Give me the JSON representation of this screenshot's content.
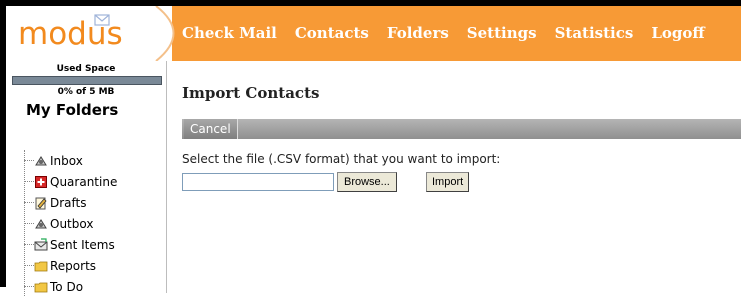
{
  "app": {
    "logo_text": "modus"
  },
  "nav": {
    "items": [
      {
        "label": "Check Mail"
      },
      {
        "label": "Contacts"
      },
      {
        "label": "Folders"
      },
      {
        "label": "Settings"
      },
      {
        "label": "Statistics"
      },
      {
        "label": "Logoff"
      }
    ]
  },
  "sidebar": {
    "used_space_label": "Used Space",
    "used_space_text": "0% of 5 MB",
    "used_space_fraction": 0.0,
    "my_folders_title": "My Folders",
    "folders": [
      {
        "label": "Inbox",
        "icon": "inbox-icon"
      },
      {
        "label": "Quarantine",
        "icon": "quarantine-icon"
      },
      {
        "label": "Drafts",
        "icon": "drafts-icon"
      },
      {
        "label": "Outbox",
        "icon": "outbox-icon"
      },
      {
        "label": "Sent Items",
        "icon": "sent-items-icon"
      },
      {
        "label": "Reports",
        "icon": "folder-icon"
      },
      {
        "label": "To Do",
        "icon": "folder-icon"
      }
    ]
  },
  "main": {
    "title": "Import Contacts",
    "toolbar": {
      "cancel_label": "Cancel"
    },
    "instructions": "Select the file (.CSV format) that you want to import:",
    "file_input_value": "",
    "browse_label": "Browse...",
    "import_label": "Import"
  },
  "colors": {
    "header_orange": "#f79a36",
    "logo_orange": "#f28a1e",
    "toolbar_gray": "#9e9e9e",
    "usage_bar": "#7a8997"
  }
}
